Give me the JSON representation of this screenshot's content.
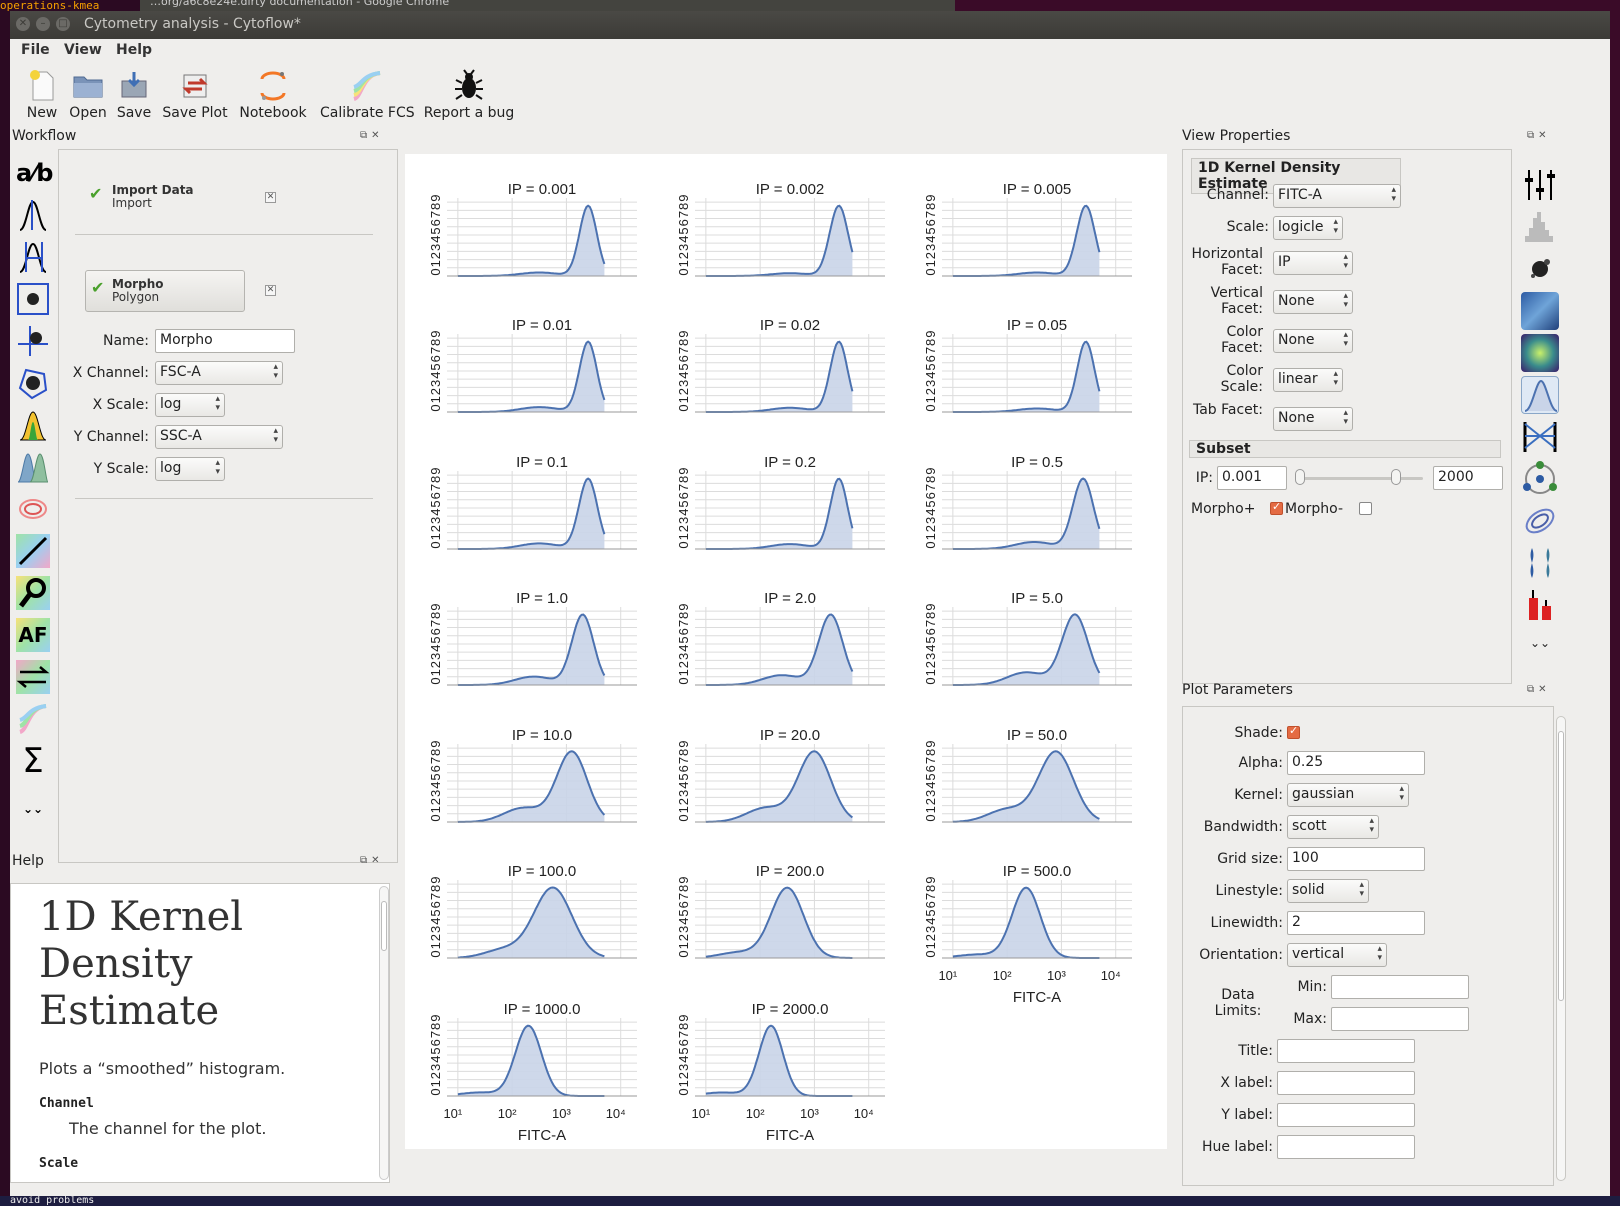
{
  "background": {
    "browser_title": "…org/a6c8e24e.dirty documentation - Google Chrome",
    "terminal_top": "operations-kmea",
    "terminal_bottom": "avoid problems"
  },
  "window": {
    "title": "Cytometry analysis - Cytoflow*"
  },
  "menu": [
    "File",
    "View",
    "Help"
  ],
  "toolbar": [
    {
      "label": "New",
      "icon": "new-file-icon"
    },
    {
      "label": "Open",
      "icon": "folder-icon"
    },
    {
      "label": "Save",
      "icon": "save-icon"
    },
    {
      "label": "Save Plot",
      "icon": "save-plot-icon"
    },
    {
      "label": "Notebook",
      "icon": "jupyter-icon"
    },
    {
      "label": "Calibrate FCS",
      "icon": "rainbow-icon"
    },
    {
      "label": "Report a bug",
      "icon": "bug-icon"
    }
  ],
  "workflow": {
    "title": "Workflow",
    "operations": [
      {
        "name": "Import Data",
        "subtitle": "Import",
        "status": "ok"
      },
      {
        "name": "Morpho",
        "subtitle": "Polygon",
        "status": "ok"
      }
    ],
    "form": {
      "name_label": "Name:",
      "name_value": "Morpho",
      "xchannel_label": "X Channel:",
      "xchannel_value": "FSC-A",
      "xscale_label": "X Scale:",
      "xscale_value": "log",
      "ychannel_label": "Y Channel:",
      "ychannel_value": "SSC-A",
      "yscale_label": "Y Scale:",
      "yscale_value": "log"
    },
    "tool_icons": [
      "ratio-icon",
      "threshold-icon",
      "range-icon",
      "polygon-gate-icon",
      "quad-icon",
      "polygon-icon",
      "density-gate-icon",
      "gaussian-mixture-icon",
      "range2d-icon",
      "ratio-line-icon",
      "binning-icon",
      "autofluorescence-icon",
      "bleedthrough-icon",
      "bead-calibration-icon",
      "sum-icon"
    ],
    "af_text": "AF",
    "sum_text": "Σ",
    "ab_text": "a⁄b"
  },
  "help": {
    "title": "Help",
    "heading": "1D Kernel Density Estimate",
    "description": "Plots a “smoothed” histogram.",
    "param1_name": "Channel",
    "param1_desc": "The channel for the plot.",
    "param2_name": "Scale"
  },
  "view_properties": {
    "title": "View Properties",
    "view_name": "1D Kernel Density Estimate",
    "fields": [
      {
        "label": "Channel:",
        "value": "FITC-A"
      },
      {
        "label": "Scale:",
        "value": "logicle"
      },
      {
        "label": "Horizontal Facet:",
        "value": "IP"
      },
      {
        "label": "Vertical Facet:",
        "value": "None"
      },
      {
        "label": "Color Facet:",
        "value": "None"
      },
      {
        "label": "Color Scale:",
        "value": "linear"
      },
      {
        "label": "Tab Facet:",
        "value": "None"
      }
    ],
    "subset": {
      "title": "Subset",
      "ip_label": "IP:",
      "ip_min": "0.001",
      "ip_max": "2000",
      "morpho_plus": "Morpho+",
      "morpho_plus_checked": true,
      "morpho_minus": "Morpho-",
      "morpho_minus_checked": false
    },
    "view_icons": [
      "view-parameters-icon",
      "histogram-icon",
      "scatterplot-icon",
      "density-plot-icon",
      "2d-histogram-icon",
      "kde-1d-icon",
      "parallel-coords-icon",
      "radviz-icon",
      "kde-2d-icon",
      "violin-icon",
      "bar-chart-icon"
    ]
  },
  "plot_parameters": {
    "title": "Plot Parameters",
    "shade_label": "Shade:",
    "shade_checked": true,
    "alpha_label": "Alpha:",
    "alpha_value": "0.25",
    "kernel_label": "Kernel:",
    "kernel_value": "gaussian",
    "bandwidth_label": "Bandwidth:",
    "bandwidth_value": "scott",
    "gridsize_label": "Grid size:",
    "gridsize_value": "100",
    "linestyle_label": "Linestyle:",
    "linestyle_value": "solid",
    "linewidth_label": "Linewidth:",
    "linewidth_value": "2",
    "orientation_label": "Orientation:",
    "orientation_value": "vertical",
    "datalimits_label": "Data Limits:",
    "min_label": "Min:",
    "max_label": "Max:",
    "title_label": "Title:",
    "xlabel_label": "X label:",
    "ylabel_label": "Y label:",
    "huelabel_label": "Hue label:"
  },
  "colors": {
    "kde_line": "#4c72b0",
    "kde_fill": "#c9d4e8",
    "accent_check": "#e46b43",
    "ok_check": "#4aa02c"
  },
  "chart_data": {
    "type": "area",
    "xlabel": "FITC-A",
    "x_scale": "logicle",
    "x_ticks": [
      "10¹",
      "10²",
      "10³",
      "10⁴"
    ],
    "y_ticks": [
      "0",
      "1",
      "2",
      "3",
      "4",
      "5",
      "6",
      "7",
      "8",
      "9"
    ],
    "grid": true,
    "facets": [
      {
        "title": "IP = 0.001",
        "peak_log10": 3.4,
        "width": 0.16,
        "shoulder": 0.05
      },
      {
        "title": "IP = 0.002",
        "peak_log10": 3.45,
        "width": 0.17,
        "shoulder": 0.04
      },
      {
        "title": "IP = 0.005",
        "peak_log10": 3.45,
        "width": 0.17,
        "shoulder": 0.05
      },
      {
        "title": "IP = 0.01",
        "peak_log10": 3.4,
        "width": 0.16,
        "shoulder": 0.07
      },
      {
        "title": "IP = 0.02",
        "peak_log10": 3.45,
        "width": 0.16,
        "shoulder": 0.06
      },
      {
        "title": "IP = 0.05",
        "peak_log10": 3.45,
        "width": 0.16,
        "shoulder": 0.05
      },
      {
        "title": "IP = 0.1",
        "peak_log10": 3.4,
        "width": 0.17,
        "shoulder": 0.08
      },
      {
        "title": "IP = 0.2",
        "peak_log10": 3.45,
        "width": 0.16,
        "shoulder": 0.07
      },
      {
        "title": "IP = 0.5",
        "peak_log10": 3.4,
        "width": 0.19,
        "shoulder": 0.1
      },
      {
        "title": "IP = 1.0",
        "peak_log10": 3.3,
        "width": 0.2,
        "shoulder": 0.12
      },
      {
        "title": "IP = 2.0",
        "peak_log10": 3.3,
        "width": 0.22,
        "shoulder": 0.14
      },
      {
        "title": "IP = 5.0",
        "peak_log10": 3.25,
        "width": 0.24,
        "shoulder": 0.18
      },
      {
        "title": "IP = 10.0",
        "peak_log10": 3.1,
        "width": 0.28,
        "shoulder": 0.2
      },
      {
        "title": "IP = 20.0",
        "peak_log10": 3.0,
        "width": 0.3,
        "shoulder": 0.2
      },
      {
        "title": "IP = 50.0",
        "peak_log10": 2.9,
        "width": 0.32,
        "shoulder": 0.18
      },
      {
        "title": "IP = 100.0",
        "peak_log10": 2.75,
        "width": 0.35,
        "shoulder": 0.12
      },
      {
        "title": "IP = 200.0",
        "peak_log10": 2.5,
        "width": 0.3,
        "shoulder": 0.08
      },
      {
        "title": "IP = 500.0",
        "peak_log10": 2.35,
        "width": 0.26,
        "shoulder": 0.05
      },
      {
        "title": "IP = 1000.0",
        "peak_log10": 2.3,
        "width": 0.24,
        "shoulder": 0.05
      },
      {
        "title": "IP = 2000.0",
        "peak_log10": 2.2,
        "width": 0.22,
        "shoulder": 0.05
      }
    ]
  }
}
